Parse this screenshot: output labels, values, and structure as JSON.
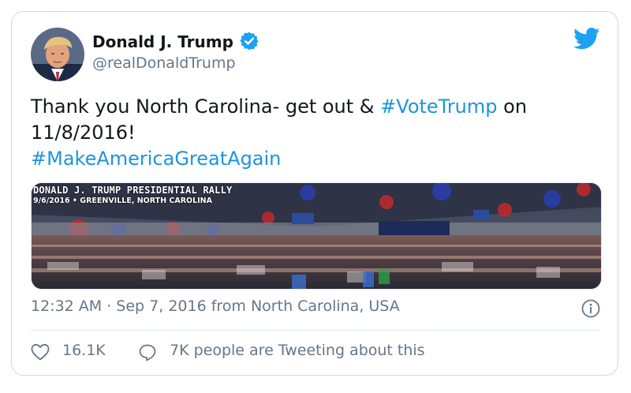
{
  "tweet": {
    "author_name": "Donald J. Trump",
    "handle": "@realDonaldTrump",
    "verified_icon": "verified-badge-icon",
    "brand_icon": "twitter-bird-icon",
    "text_part1": "Thank you North Carolina- get out & ",
    "hashtag1": "#VoteTrump",
    "text_part2": " on 11/8/2016!",
    "hashtag2": "#MakeAmericaGreatAgain",
    "media_overlay_title": "DONALD J. TRUMP PRESIDENTIAL RALLY",
    "media_overlay_subtitle": "9/6/2016 • GREENVILLE, NORTH CAROLINA",
    "timestamp": "12:32 AM · Sep 7, 2016 from North Carolina, USA",
    "like_count": "16.1K",
    "tweeting_text": "7K people are Tweeting about this"
  },
  "colors": {
    "hashtag": "#1b95e0",
    "twitter_blue": "#1da1f2",
    "secondary_text": "#657786",
    "border": "#cfd9de"
  }
}
